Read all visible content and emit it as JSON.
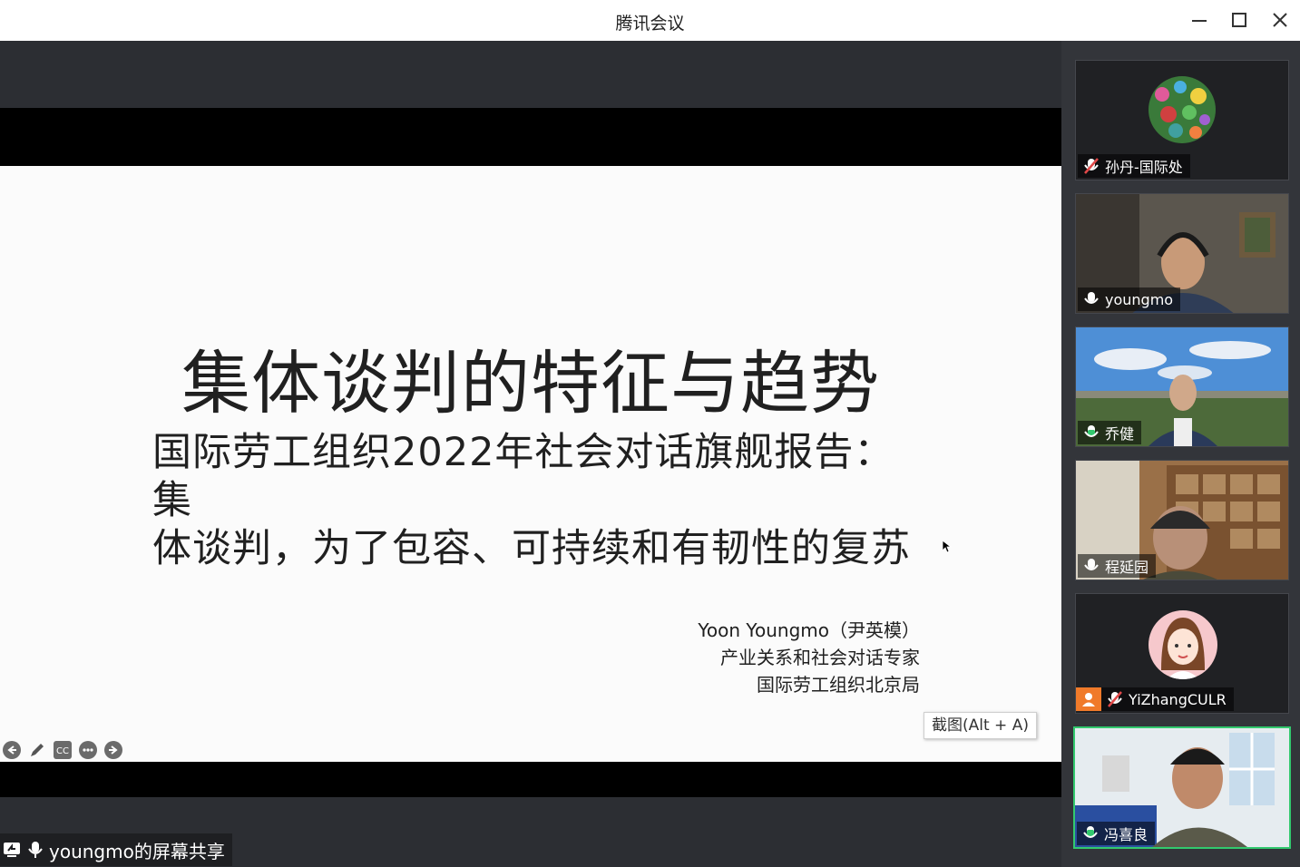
{
  "window": {
    "title": "腾讯会议",
    "icons": [
      "minimize-icon",
      "maximize-icon",
      "close-icon"
    ]
  },
  "slide": {
    "title": "集体谈判的特征与趋势",
    "subtitle_line1": "国际劳工组织2022年社会对话旗舰报告：集",
    "subtitle_line2": "体谈判，为了包容、可持续和有韧性的复苏",
    "author_line1": "Yoon Youngmo（尹英模）",
    "author_line2": "产业关系和社会对话专家",
    "author_line3": "国际劳工组织北京局",
    "screenshot_hint": "截图(Alt + A)",
    "toolbar_icons": [
      "prev-icon",
      "pen-icon",
      "cc-icon",
      "more-icon",
      "next-icon"
    ]
  },
  "share": {
    "label": "youngmo的屏幕共享"
  },
  "participants": [
    {
      "name": "孙丹-国际处",
      "mic": "muted"
    },
    {
      "name": "youngmo",
      "mic": "on"
    },
    {
      "name": "乔健",
      "mic": "on"
    },
    {
      "name": "程延园",
      "mic": "on"
    },
    {
      "name": "YiZhangCULR",
      "mic": "muted"
    },
    {
      "name": "冯喜良",
      "mic": "speaking"
    }
  ],
  "colors": {
    "accent_green": "#32c96e",
    "muted_red": "#e04848",
    "orange_avatar": "#f07a2a"
  }
}
